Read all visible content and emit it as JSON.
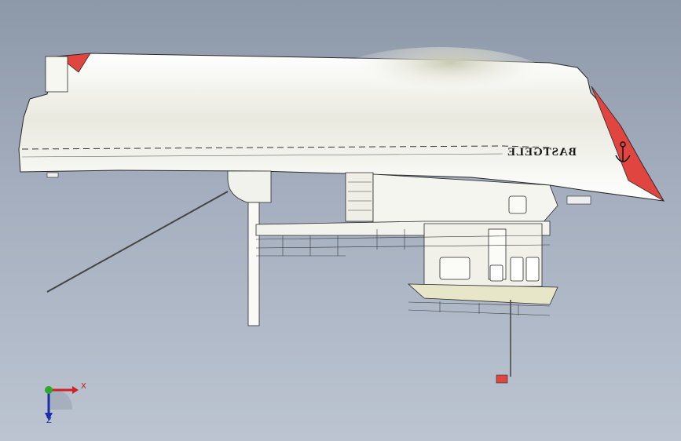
{
  "viewport": {
    "background_top": "#8d98a8",
    "background_bottom": "#bcc4d1"
  },
  "model": {
    "hull_name": "BASTGELE",
    "hull_color": "#f4f3ee",
    "accent_color": "#e0463f",
    "outline_color": "#2a2a2a"
  },
  "triad": {
    "x_label": "X",
    "z_label": "Z",
    "x_color": "#d32020",
    "y_color": "#2ea82e",
    "z_color": "#1c2fa8"
  }
}
